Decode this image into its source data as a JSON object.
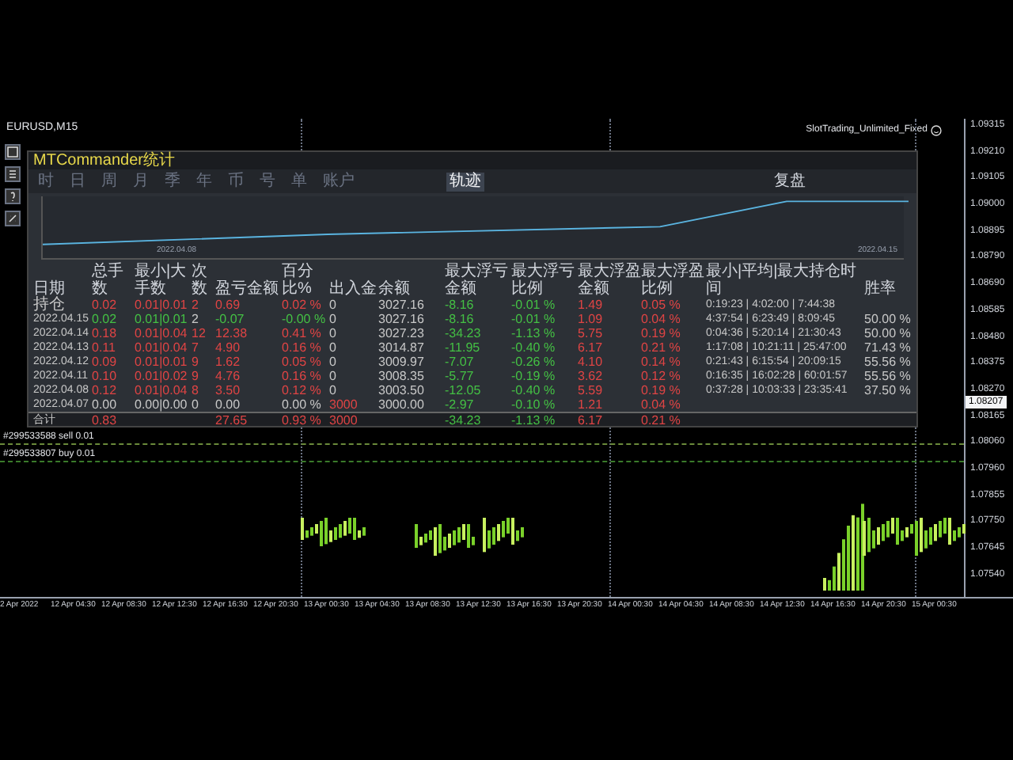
{
  "chart": {
    "symbol": "EURUSD,M15",
    "expert": "SlotTrading_Unlimited_Fixed",
    "price_ticks": [
      "1.09315",
      "1.09210",
      "1.09105",
      "1.09000",
      "1.08895",
      "1.08790",
      "1.08690",
      "1.08585",
      "1.08480",
      "1.08375",
      "1.08270",
      "1.08165",
      "1.08060",
      "1.07960",
      "1.07855",
      "1.07750",
      "1.07645",
      "1.07540"
    ],
    "current_price": "1.08207",
    "time_ticks": [
      "2 Apr 2022",
      "12 Apr 04:30",
      "12 Apr 08:30",
      "12 Apr 12:30",
      "12 Apr 16:30",
      "12 Apr 20:30",
      "13 Apr 00:30",
      "13 Apr 04:30",
      "13 Apr 08:30",
      "13 Apr 12:30",
      "13 Apr 16:30",
      "13 Apr 20:30",
      "14 Apr 00:30",
      "14 Apr 04:30",
      "14 Apr 08:30",
      "14 Apr 12:30",
      "14 Apr 16:30",
      "14 Apr 20:30",
      "15 Apr 00:30"
    ],
    "orders": [
      "#299533588 sell 0.01",
      "#299533807 buy 0.01"
    ]
  },
  "panel": {
    "title": "MTCommander统计",
    "tabs": [
      {
        "label": "时",
        "selected": false
      },
      {
        "label": "日",
        "selected": false
      },
      {
        "label": "周",
        "selected": false
      },
      {
        "label": "月",
        "selected": false
      },
      {
        "label": "季",
        "selected": false
      },
      {
        "label": "年",
        "selected": false
      },
      {
        "label": "币",
        "selected": false
      },
      {
        "label": "号",
        "selected": false
      },
      {
        "label": "单",
        "selected": false
      },
      {
        "label": "账户",
        "selected": false
      },
      {
        "label": "轨迹",
        "selected": true
      }
    ],
    "right_button": "复盘",
    "graph": {
      "start_date": "2022.04.08",
      "end_date": "2022.04.15"
    },
    "table": {
      "columns": [
        "日期",
        "总手数",
        "最小|大手数",
        "次数",
        "盈亏金额",
        "百分比%",
        "出入金",
        "余额",
        "最大浮亏金额",
        "最大浮亏比例",
        "最大浮盈金额",
        "最大浮盈比例",
        "最小|平均|最大持仓时间",
        "胜率"
      ],
      "rows": [
        {
          "total": false,
          "cells": [
            {
              "text": "持仓"
            },
            {
              "text": "0.02",
              "color": "#e04444"
            },
            {
              "text": "0.01|0.01",
              "color": "#e04444"
            },
            {
              "text": "2",
              "color": "#e04444"
            },
            {
              "text": "0.69",
              "color": "#e04444"
            },
            {
              "text": "0.02 %",
              "color": "#e04444"
            },
            {
              "text": "0"
            },
            {
              "text": "3027.16"
            },
            {
              "text": "-8.16",
              "color": "#44c044"
            },
            {
              "text": "-0.01 %",
              "color": "#44c044"
            },
            {
              "text": "1.49",
              "color": "#e04444"
            },
            {
              "text": "0.05 %",
              "color": "#e04444"
            },
            {
              "text": "0:19:23 | 4:02:00 | 7:44:38"
            },
            null
          ]
        },
        {
          "total": false,
          "cells": [
            {
              "text": "2022.04.15"
            },
            {
              "text": "0.02",
              "color": "#44c044"
            },
            {
              "text": "0.01|0.01",
              "color": "#44c044"
            },
            {
              "text": "2"
            },
            {
              "text": "-0.07",
              "color": "#44c044"
            },
            {
              "text": "-0.00 %",
              "color": "#44c044"
            },
            {
              "text": "0"
            },
            {
              "text": "3027.16"
            },
            {
              "text": "-8.16",
              "color": "#44c044"
            },
            {
              "text": "-0.01 %",
              "color": "#44c044"
            },
            {
              "text": "1.09",
              "color": "#e04444"
            },
            {
              "text": "0.04 %",
              "color": "#e04444"
            },
            {
              "text": "4:37:54 | 6:23:49 | 8:09:45"
            },
            {
              "text": "50.00 %"
            }
          ]
        },
        {
          "total": false,
          "cells": [
            {
              "text": "2022.04.14"
            },
            {
              "text": "0.18",
              "color": "#e04444"
            },
            {
              "text": "0.01|0.04",
              "color": "#e04444"
            },
            {
              "text": "12",
              "color": "#e04444"
            },
            {
              "text": "12.38",
              "color": "#e04444"
            },
            {
              "text": "0.41 %",
              "color": "#e04444"
            },
            {
              "text": "0"
            },
            {
              "text": "3027.23"
            },
            {
              "text": "-34.23",
              "color": "#44c044"
            },
            {
              "text": "-1.13 %",
              "color": "#44c044"
            },
            {
              "text": "5.75",
              "color": "#e04444"
            },
            {
              "text": "0.19 %",
              "color": "#e04444"
            },
            {
              "text": "0:04:36 | 5:20:14 | 21:30:43"
            },
            {
              "text": "50.00 %"
            }
          ]
        },
        {
          "total": false,
          "cells": [
            {
              "text": "2022.04.13"
            },
            {
              "text": "0.11",
              "color": "#e04444"
            },
            {
              "text": "0.01|0.04",
              "color": "#e04444"
            },
            {
              "text": "7",
              "color": "#e04444"
            },
            {
              "text": "4.90",
              "color": "#e04444"
            },
            {
              "text": "0.16 %",
              "color": "#e04444"
            },
            {
              "text": "0"
            },
            {
              "text": "3014.87"
            },
            {
              "text": "-11.95",
              "color": "#44c044"
            },
            {
              "text": "-0.40 %",
              "color": "#44c044"
            },
            {
              "text": "6.17",
              "color": "#e04444"
            },
            {
              "text": "0.21 %",
              "color": "#e04444"
            },
            {
              "text": "1:17:08 | 10:21:11 | 25:47:00"
            },
            {
              "text": "71.43 %"
            }
          ]
        },
        {
          "total": false,
          "cells": [
            {
              "text": "2022.04.12"
            },
            {
              "text": "0.09",
              "color": "#e04444"
            },
            {
              "text": "0.01|0.01",
              "color": "#e04444"
            },
            {
              "text": "9",
              "color": "#e04444"
            },
            {
              "text": "1.62",
              "color": "#e04444"
            },
            {
              "text": "0.05 %",
              "color": "#e04444"
            },
            {
              "text": "0"
            },
            {
              "text": "3009.97"
            },
            {
              "text": "-7.07",
              "color": "#44c044"
            },
            {
              "text": "-0.26 %",
              "color": "#44c044"
            },
            {
              "text": "4.10",
              "color": "#e04444"
            },
            {
              "text": "0.14 %",
              "color": "#e04444"
            },
            {
              "text": "0:21:43 | 6:15:54 | 20:09:15"
            },
            {
              "text": "55.56 %"
            }
          ]
        },
        {
          "total": false,
          "cells": [
            {
              "text": "2022.04.11"
            },
            {
              "text": "0.10",
              "color": "#e04444"
            },
            {
              "text": "0.01|0.02",
              "color": "#e04444"
            },
            {
              "text": "9",
              "color": "#e04444"
            },
            {
              "text": "4.76",
              "color": "#e04444"
            },
            {
              "text": "0.16 %",
              "color": "#e04444"
            },
            {
              "text": "0"
            },
            {
              "text": "3008.35"
            },
            {
              "text": "-5.77",
              "color": "#44c044"
            },
            {
              "text": "-0.19 %",
              "color": "#44c044"
            },
            {
              "text": "3.62",
              "color": "#e04444"
            },
            {
              "text": "0.12 %",
              "color": "#e04444"
            },
            {
              "text": "0:16:35 | 16:02:28 | 60:01:57"
            },
            {
              "text": "55.56 %"
            }
          ]
        },
        {
          "total": false,
          "cells": [
            {
              "text": "2022.04.08"
            },
            {
              "text": "0.12",
              "color": "#e04444"
            },
            {
              "text": "0.01|0.04",
              "color": "#e04444"
            },
            {
              "text": "8",
              "color": "#e04444"
            },
            {
              "text": "3.50",
              "color": "#e04444"
            },
            {
              "text": "0.12 %",
              "color": "#e04444"
            },
            {
              "text": "0"
            },
            {
              "text": "3003.50"
            },
            {
              "text": "-12.05",
              "color": "#44c044"
            },
            {
              "text": "-0.40 %",
              "color": "#44c044"
            },
            {
              "text": "5.59",
              "color": "#e04444"
            },
            {
              "text": "0.19 %",
              "color": "#e04444"
            },
            {
              "text": "0:37:28 | 10:03:33 | 23:35:41"
            },
            {
              "text": "37.50 %"
            }
          ]
        },
        {
          "total": false,
          "cells": [
            {
              "text": "2022.04.07"
            },
            {
              "text": "0.00"
            },
            {
              "text": "0.00|0.00"
            },
            {
              "text": "0"
            },
            {
              "text": "0.00"
            },
            {
              "text": "0.00 %"
            },
            {
              "text": "3000",
              "color": "#e04444"
            },
            {
              "text": "3000.00"
            },
            {
              "text": "-2.97",
              "color": "#44c044"
            },
            {
              "text": "-0.10 %",
              "color": "#44c044"
            },
            {
              "text": "1.21",
              "color": "#e04444"
            },
            {
              "text": "0.04 %",
              "color": "#e04444"
            },
            null,
            null
          ]
        },
        {
          "total": true,
          "cells": [
            {
              "text": "合计"
            },
            {
              "text": "0.83",
              "color": "#e04444"
            },
            null,
            null,
            {
              "text": "27.65",
              "color": "#e04444"
            },
            {
              "text": "0.93 %",
              "color": "#e04444"
            },
            {
              "text": "3000",
              "color": "#e04444"
            },
            null,
            {
              "text": "-34.23",
              "color": "#44c044"
            },
            {
              "text": "-1.13 %",
              "color": "#44c044"
            },
            {
              "text": "6.17",
              "color": "#e04444"
            },
            {
              "text": "0.21 %",
              "color": "#e04444"
            },
            null,
            null
          ]
        }
      ]
    }
  }
}
